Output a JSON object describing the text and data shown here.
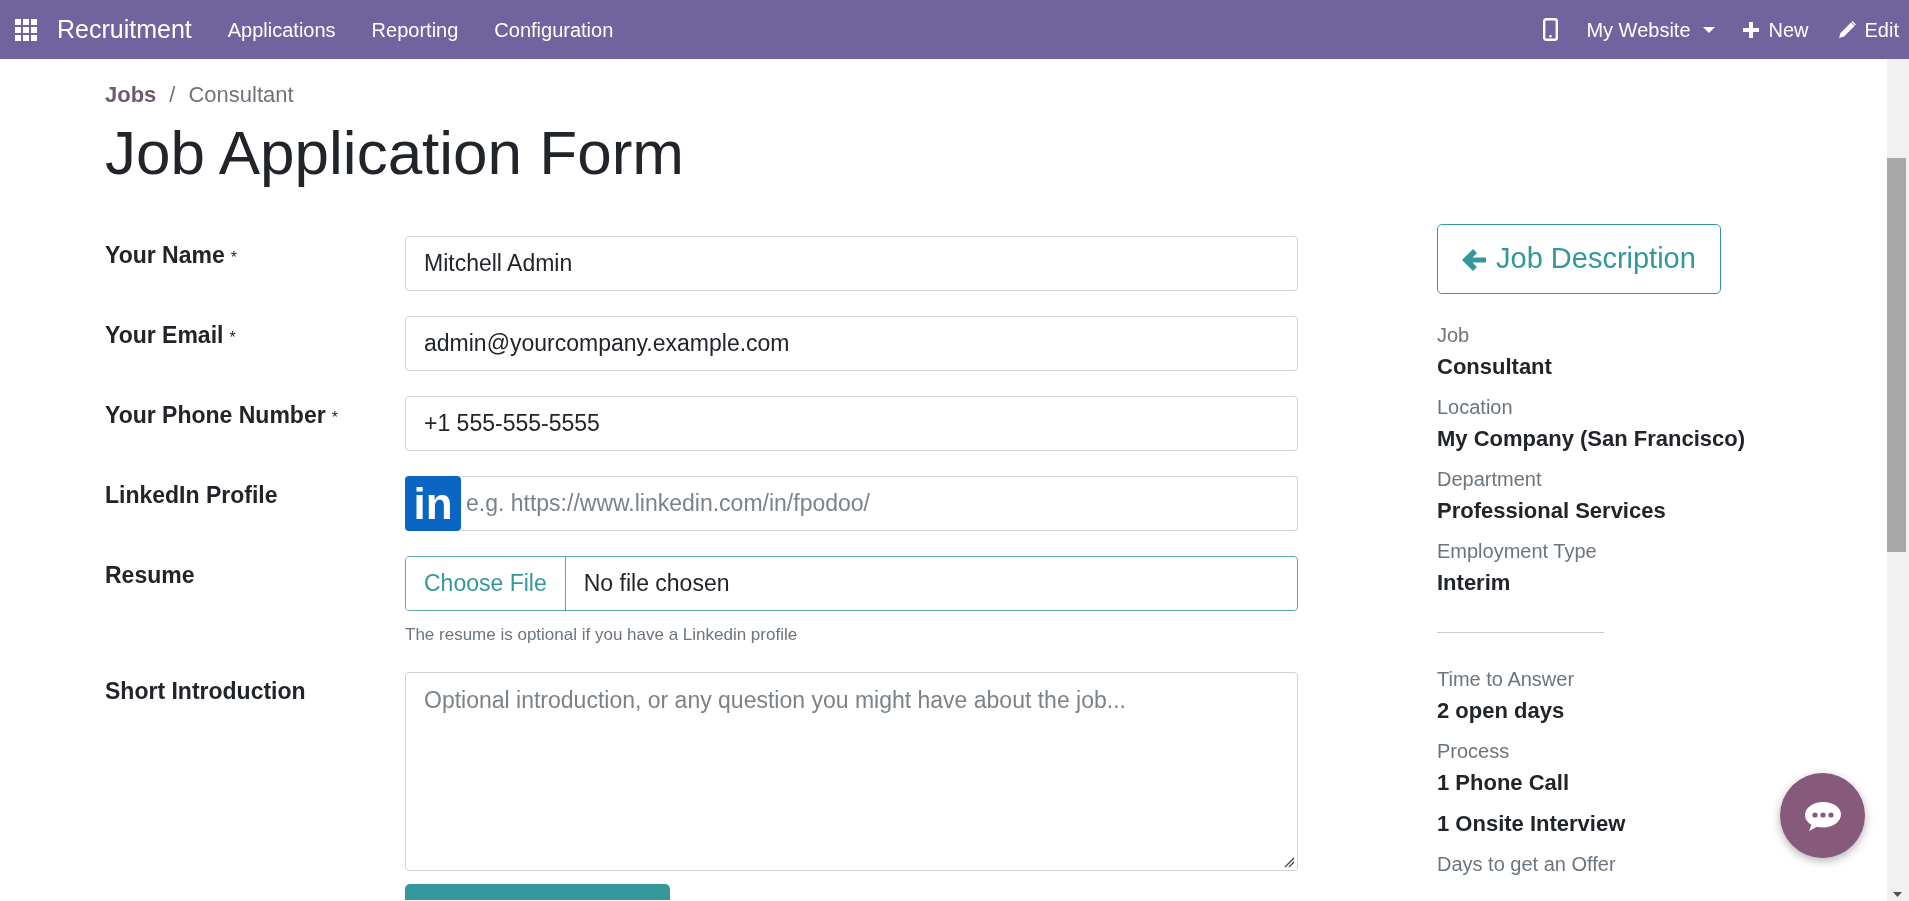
{
  "navbar": {
    "app_name": "Recruitment",
    "menu": [
      {
        "label": "Applications"
      },
      {
        "label": "Reporting"
      },
      {
        "label": "Configuration"
      }
    ],
    "website": "My Website",
    "new": "New",
    "edit": "Edit"
  },
  "breadcrumb": [
    {
      "label": "Jobs",
      "kind": "link"
    },
    {
      "label": "Consultant",
      "kind": "current"
    }
  ],
  "breadcrumb_separator": "/",
  "title": "Job Application Form",
  "fields": [
    {
      "kind": "text",
      "label": "Your Name",
      "required_mark": "*",
      "value": "Mitchell Admin"
    },
    {
      "kind": "text",
      "label": "Your Email",
      "required_mark": "*",
      "value": "admin@yourcompany.example.com"
    },
    {
      "kind": "text",
      "label": "Your Phone Number",
      "required_mark": "*",
      "value": "+1 555-555-5555"
    },
    {
      "kind": "linkedin",
      "label": "LinkedIn Profile",
      "logo_text": "in",
      "placeholder": "e.g. https://www.linkedin.com/in/fpodoo/"
    },
    {
      "kind": "file",
      "label": "Resume",
      "button_label": "Choose File",
      "value": "No file chosen",
      "help": "The resume is optional if you have a Linkedin profile"
    },
    {
      "kind": "textarea",
      "label": "Short Introduction",
      "placeholder": "Optional introduction, or any question you might have about the job..."
    }
  ],
  "sidebar": {
    "job_description_button": "Job Description",
    "job_details": [
      {
        "label": "Job",
        "values": [
          "Consultant"
        ]
      },
      {
        "label": "Location",
        "values": [
          "My Company (San Francisco)"
        ]
      },
      {
        "label": "Department",
        "values": [
          "Professional Services"
        ]
      },
      {
        "label": "Employment Type",
        "values": [
          "Interim"
        ]
      }
    ],
    "hiring_details": [
      {
        "label": "Time to Answer",
        "values": [
          "2 open days"
        ]
      },
      {
        "label": "Process",
        "values": [
          "1 Phone Call",
          "1 Onsite Interview"
        ]
      },
      {
        "label": "Days to get an Offer"
      }
    ]
  }
}
